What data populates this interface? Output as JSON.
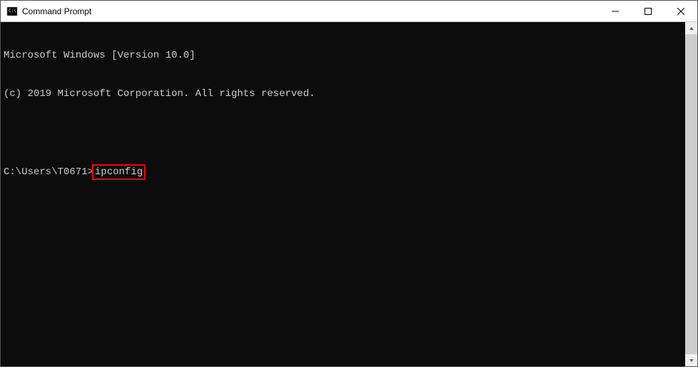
{
  "window": {
    "title": "Command Prompt"
  },
  "terminal": {
    "line1": "Microsoft Windows [Version 10.0]",
    "line2": "(c) 2019 Microsoft Corporation. All rights reserved.",
    "prompt": "C:\\Users\\T0671>",
    "command": "ipconfig"
  }
}
